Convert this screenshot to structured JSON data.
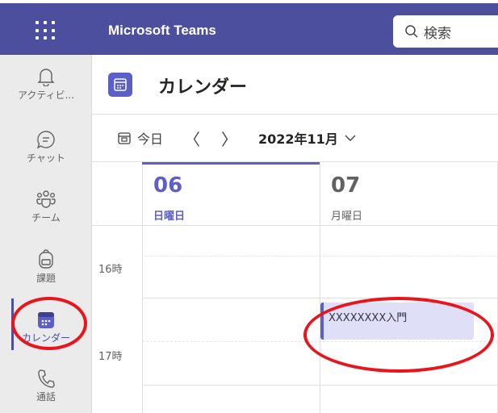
{
  "app": {
    "title": "Microsoft Teams"
  },
  "search": {
    "placeholder": "検索"
  },
  "rail": [
    {
      "label": "アクティビ...",
      "icon": "bell-icon"
    },
    {
      "label": "チャット",
      "icon": "chat-icon"
    },
    {
      "label": "チーム",
      "icon": "teams-icon"
    },
    {
      "label": "課題",
      "icon": "backpack-icon"
    },
    {
      "label": "カレンダー",
      "icon": "calendar-icon",
      "active": true
    },
    {
      "label": "通話",
      "icon": "phone-icon"
    }
  ],
  "header": {
    "title": "カレンダー"
  },
  "toolbar": {
    "today": "今日",
    "prev": "〈",
    "next": "〉",
    "month": "2022年11月"
  },
  "days": [
    {
      "num": "06",
      "name": "日曜日",
      "today": true
    },
    {
      "num": "07",
      "name": "月曜日"
    }
  ],
  "hours": [
    "16時",
    "17時"
  ],
  "event": {
    "title": "XXXXXXXX入門"
  },
  "colors": {
    "brand": "#4b4f9e",
    "accent": "#5b5fc7",
    "annotation": "#e8151c"
  }
}
